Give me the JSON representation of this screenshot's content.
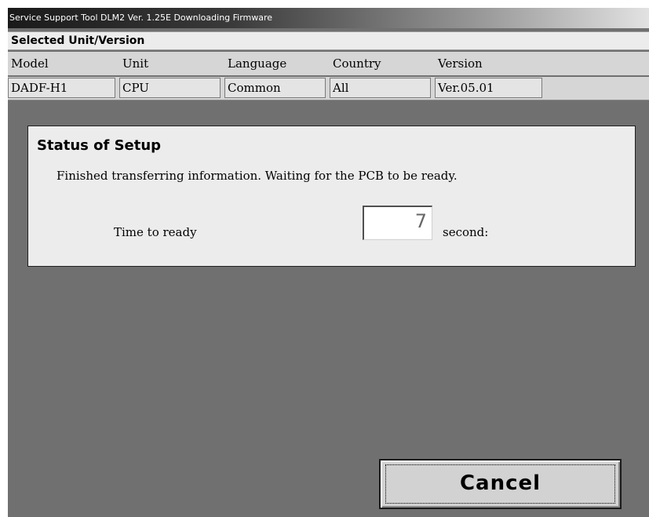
{
  "window": {
    "title": "Service Support Tool DLM2 Ver. 1.25E  Downloading Firmware"
  },
  "selected": {
    "header": "Selected Unit/Version",
    "columns": [
      "Model",
      "Unit",
      "Language",
      "Country",
      "Version"
    ],
    "values": [
      "DADF-H1",
      "CPU",
      "Common",
      "All",
      "Ver.05.01"
    ]
  },
  "status": {
    "title": "Status of Setup",
    "message": "Finished transferring information. Waiting for the PCB to be ready.",
    "time_label": "Time to ready",
    "time_value": "7",
    "time_unit": "second:"
  },
  "actions": {
    "cancel_label": "Cancel"
  }
}
